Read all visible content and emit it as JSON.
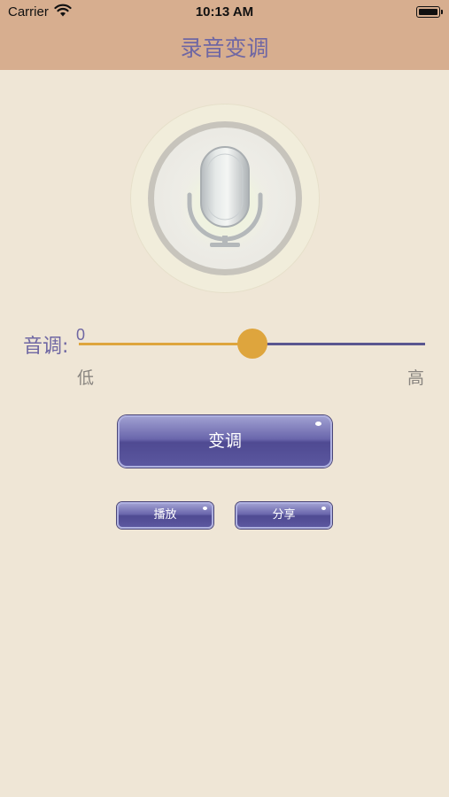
{
  "status_bar": {
    "carrier": "Carrier",
    "time": "10:13 AM",
    "wifi_icon": "wifi-icon",
    "battery_icon": "battery-icon"
  },
  "nav": {
    "title": "录音变调"
  },
  "mic": {
    "icon": "microphone-icon"
  },
  "pitch": {
    "label": "音调:",
    "value": "0",
    "min_label": "低",
    "max_label": "高",
    "slider_fraction": 0.5
  },
  "buttons": {
    "transform": "变调",
    "play": "播放",
    "share": "分享"
  },
  "colors": {
    "bar": "#d7ae8f",
    "background": "#efe6d6",
    "accent": "#dea53d",
    "button": "#5b579f",
    "text": "#6f67a3"
  }
}
